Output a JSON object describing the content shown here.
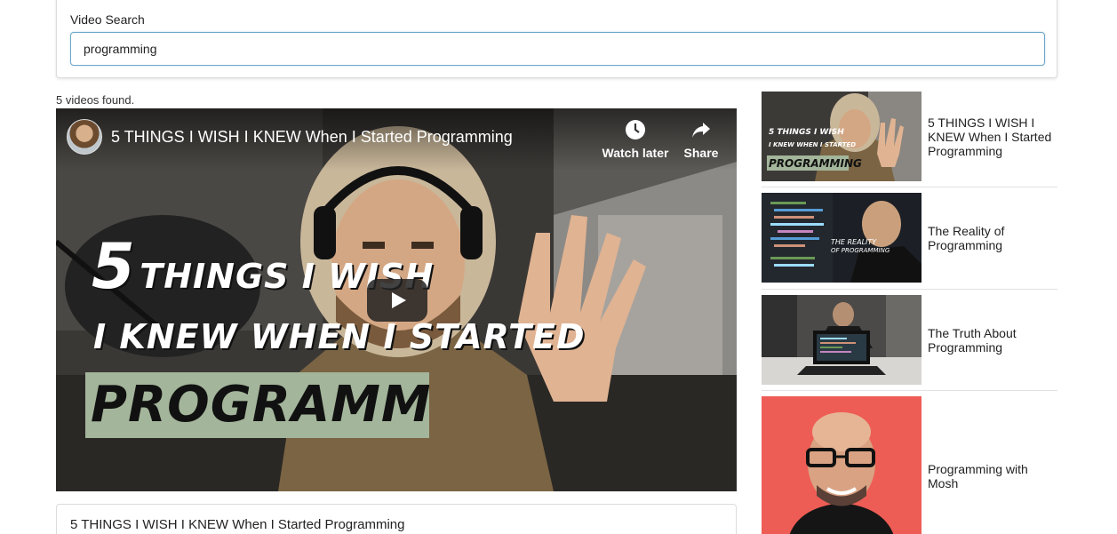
{
  "search": {
    "label": "Video Search",
    "value": "programming"
  },
  "results": {
    "count_text": "5 videos found."
  },
  "player": {
    "title": "5 THINGS I WISH I KNEW When I Started Programming",
    "watch_later_label": "Watch later",
    "share_label": "Share",
    "overlay_number": "5",
    "overlay_line1": "THINGS I WISH",
    "overlay_line2": "I KNEW WHEN I STARTED",
    "overlay_banner": "PROGRAMMING"
  },
  "detail": {
    "title": "5 THINGS I WISH I KNEW When I Started Programming"
  },
  "video_list": [
    {
      "title": "5 THINGS I WISH I KNEW When I Started Programming",
      "thumb_text_1": "5 THINGS I WISH",
      "thumb_text_2": "I KNEW WHEN I STARTED",
      "thumb_text_3": "PROGRAMMING"
    },
    {
      "title": "The Reality of Programming",
      "thumb_text_1": "THE REALITY",
      "thumb_text_2": "OF PROGRAMMING"
    },
    {
      "title": "The Truth About Programming"
    },
    {
      "title": "Programming with Mosh"
    }
  ],
  "colors": {
    "input_border": "#6ea8c8",
    "banner_green": "#a3b59a",
    "mosh_background": "#ee5d55"
  }
}
